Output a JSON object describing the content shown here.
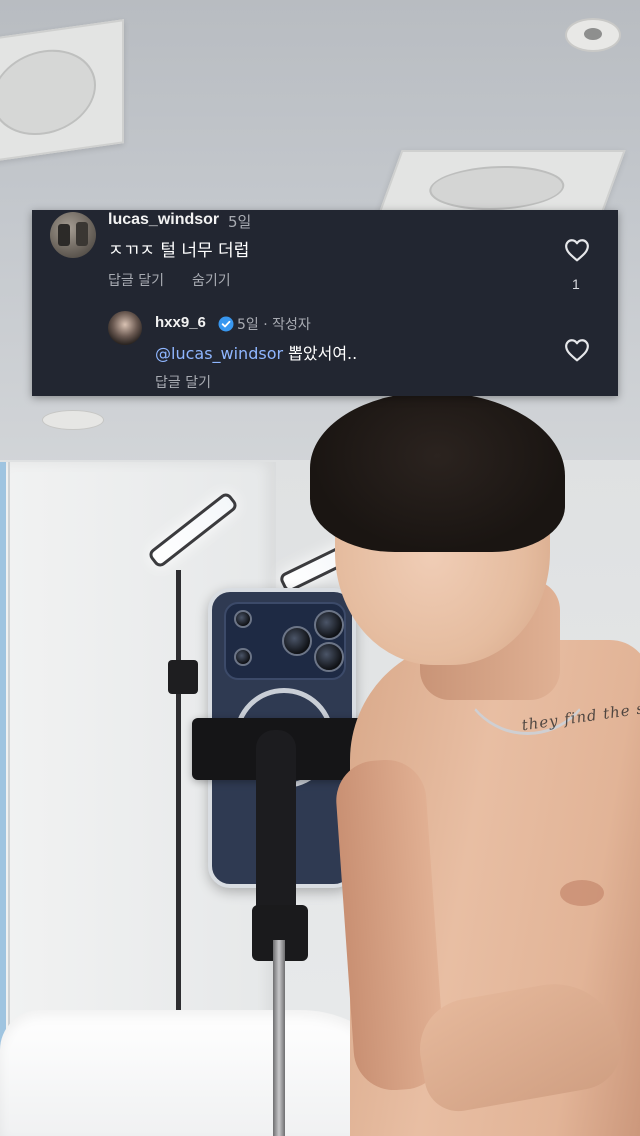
{
  "comment": {
    "username": "lucas_windsor",
    "age": "5일",
    "text": "ㅈㄲㅈ 털 너무 더럽",
    "reply_action": "답글 달기",
    "hide_action": "숨기기",
    "like_count": "1"
  },
  "reply": {
    "username": "hxx9_6",
    "meta": "5일 · 작성자",
    "mention": "@lucas_windsor",
    "text": "뽑았서여..",
    "reply_action": "답글 달기"
  },
  "background": {
    "tattoo_text": "they find the sun"
  },
  "colors": {
    "card_bg": "#222631",
    "verified_blue": "#3897f0",
    "mention_blue": "#8fb6ff"
  },
  "icons": [
    "heart-outline-icon",
    "verified-badge-icon"
  ]
}
